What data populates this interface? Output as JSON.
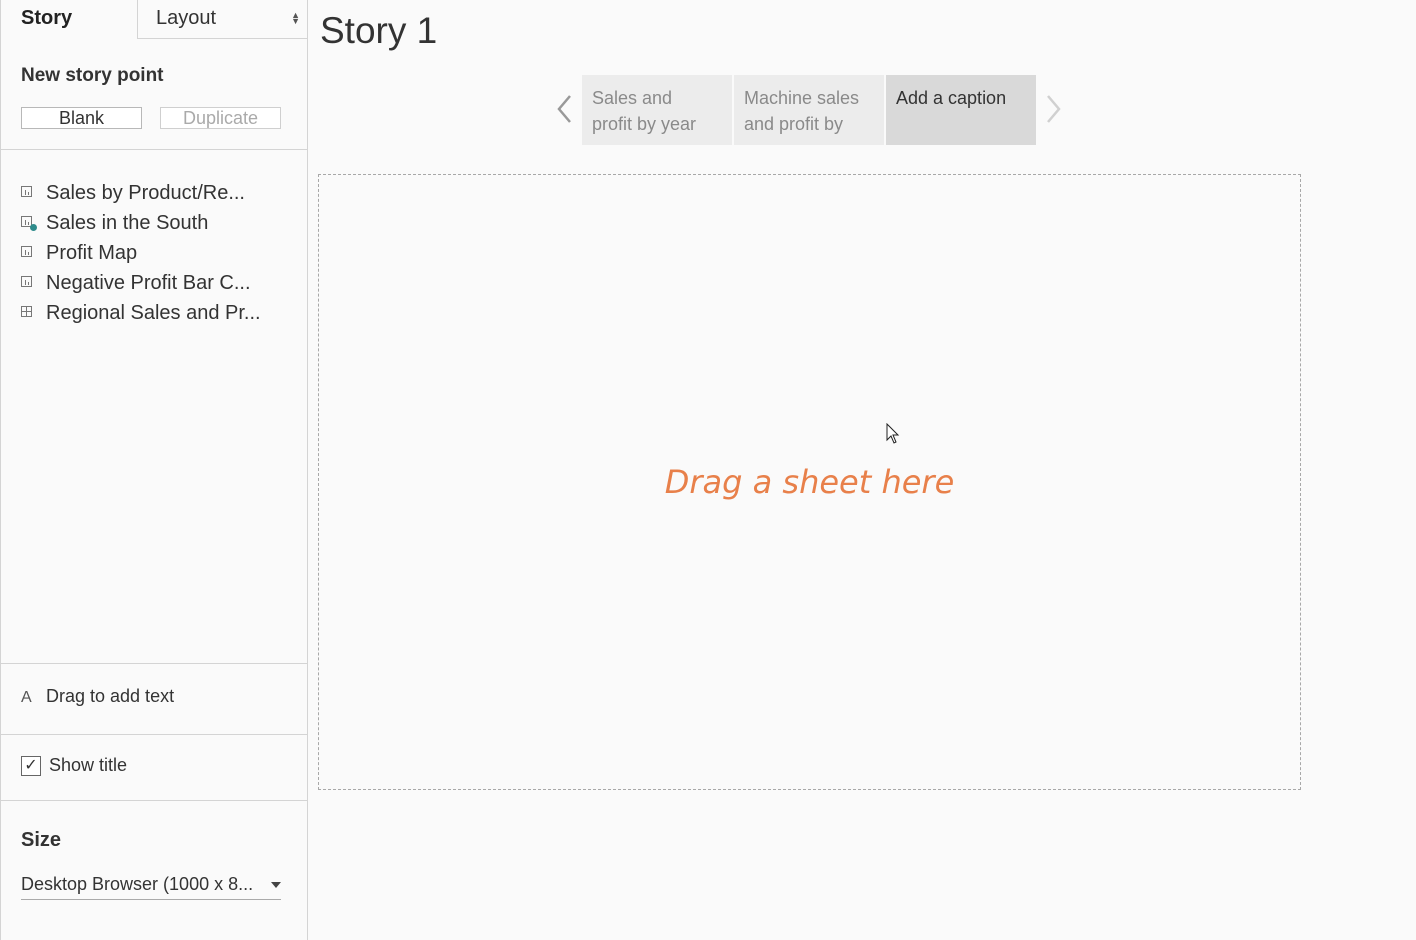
{
  "sidebar": {
    "tabs": {
      "story": "Story",
      "layout": "Layout"
    },
    "new_story_point": {
      "title": "New story point",
      "blank": "Blank",
      "duplicate": "Duplicate"
    },
    "sheets": [
      {
        "label": "Sales by Product/Re...",
        "icon": "worksheet-icon"
      },
      {
        "label": "Sales in the South",
        "icon": "worksheet-active-icon"
      },
      {
        "label": "Profit Map",
        "icon": "worksheet-icon"
      },
      {
        "label": "Negative Profit Bar C...",
        "icon": "worksheet-icon"
      },
      {
        "label": "Regional Sales and Pr...",
        "icon": "dashboard-icon"
      }
    ],
    "drag_text": {
      "icon": "A",
      "label": "Drag to add text"
    },
    "show_title": {
      "label": "Show title",
      "checked": true
    },
    "size": {
      "title": "Size",
      "selected": "Desktop Browser (1000 x 8..."
    }
  },
  "main": {
    "story_title": "Story 1",
    "story_points": [
      {
        "line1": "Sales and",
        "line2": "profit by year"
      },
      {
        "line1": "Machine sales",
        "line2": "and profit by"
      },
      {
        "line1": "Add a caption",
        "line2": ""
      }
    ],
    "drop_hint": "Drag a sheet here"
  },
  "colors": {
    "accent_hint": "#e8804a",
    "active_point_bg": "#d9d9d9",
    "inactive_point_bg": "#ececec",
    "status_dot": "#2e8b8b"
  }
}
